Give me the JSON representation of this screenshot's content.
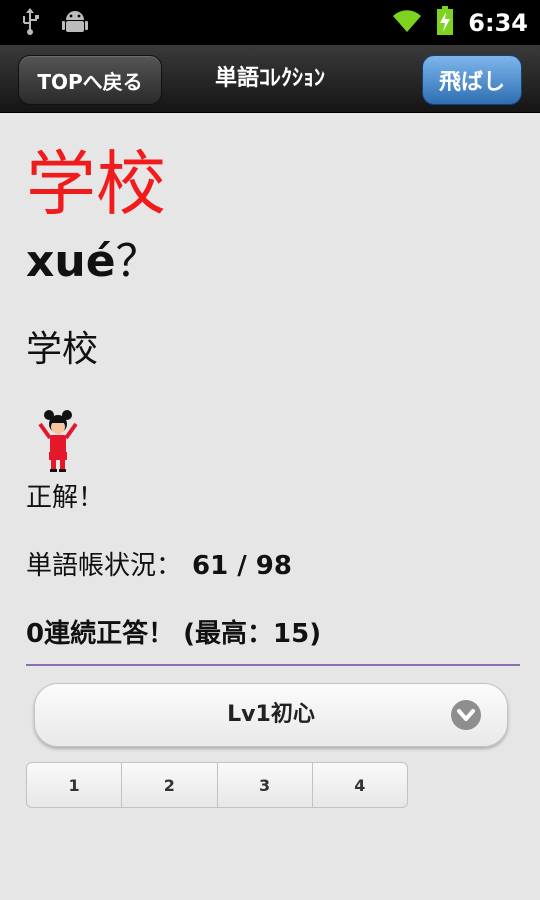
{
  "status_bar": {
    "time": "6:34",
    "icons": [
      "usb-icon",
      "android-debug-icon",
      "wifi-icon",
      "battery-charging-icon"
    ]
  },
  "title_bar": {
    "back_label": "TOPへ戻る",
    "title": "単語ｺﾚｸｼｮﾝ",
    "skip_label": "飛ばし"
  },
  "quiz": {
    "word": "学校",
    "pinyin": "xué",
    "question_mark": "？",
    "answer_word": "学校",
    "result": "正解！",
    "progress_label": "単語帳状況：",
    "progress_value": "61 / 98",
    "streak": "0連続正答！ (最高：15)"
  },
  "level": {
    "selected": "Lv1初心"
  },
  "segments": [
    "1",
    "2",
    "3",
    "4"
  ],
  "colors": {
    "word": "#f21b1b",
    "divider": "#8d6fb0",
    "skip_button": "#3f86cf"
  }
}
